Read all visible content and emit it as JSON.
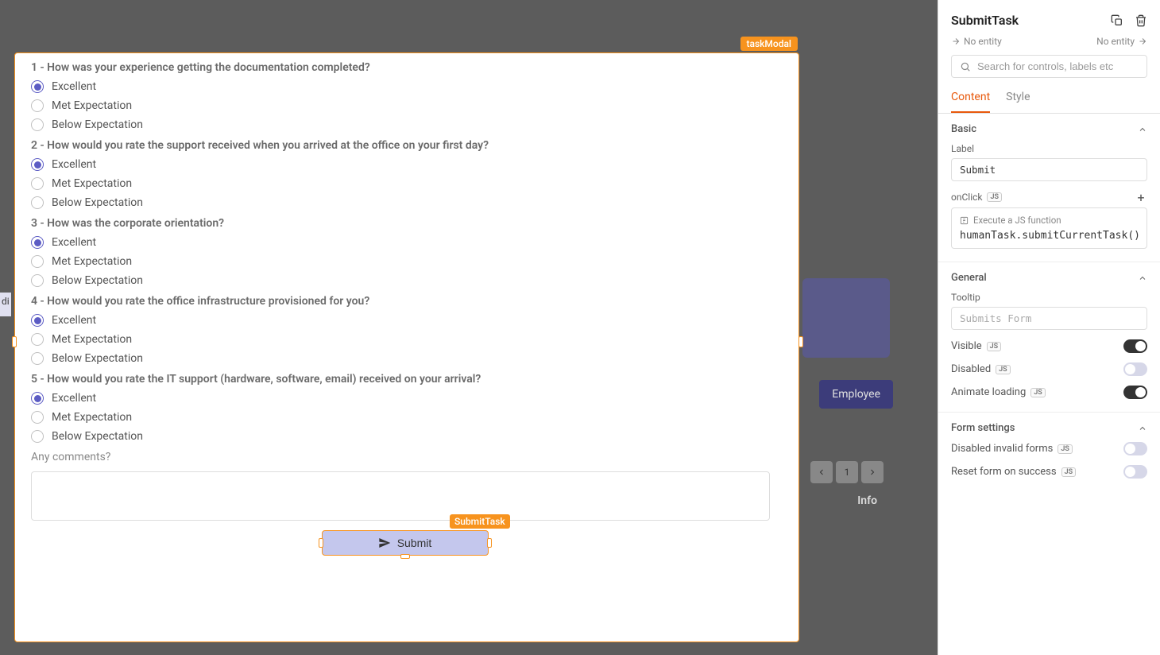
{
  "modal": {
    "tag": "taskModal",
    "questions": [
      {
        "title": "1 - How was your experience getting the documentation completed?",
        "options": [
          "Excellent",
          "Met Expectation",
          "Below Expectation"
        ],
        "selected": 0
      },
      {
        "title": "2 - How would you rate the support received when you arrived at the office on your first day?",
        "options": [
          "Excellent",
          "Met Expectation",
          "Below Expectation"
        ],
        "selected": 0
      },
      {
        "title": "3 - How was the corporate orientation?",
        "options": [
          "Excellent",
          "Met Expectation",
          "Below Expectation"
        ],
        "selected": 0
      },
      {
        "title": "4 - How would you rate the office infrastructure provisioned for you?",
        "options": [
          "Excellent",
          "Met Expectation",
          "Below Expectation"
        ],
        "selected": 0
      },
      {
        "title": "5 - How would you rate the IT support (hardware, software, email) received on your arrival?",
        "options": [
          "Excellent",
          "Met Expectation",
          "Below Expectation"
        ],
        "selected": 0
      }
    ],
    "commentsLabel": "Any comments?",
    "submit": {
      "tag": "SubmitTask",
      "label": "Submit"
    }
  },
  "background": {
    "button": "Employee",
    "info": "Info",
    "page": "1",
    "di": "di"
  },
  "panel": {
    "title": "SubmitTask",
    "entityLeft": "No entity",
    "entityRight": "No entity",
    "searchPlaceholder": "Search for controls, labels etc",
    "tabs": {
      "content": "Content",
      "style": "Style"
    },
    "basic": {
      "title": "Basic",
      "labelField": "Label",
      "labelValue": "Submit",
      "onClickField": "onClick",
      "actionHeader": "Execute a JS function",
      "actionCode": "humanTask.submitCurrentTask()"
    },
    "general": {
      "title": "General",
      "tooltipField": "Tooltip",
      "tooltipPlaceholder": "Submits Form",
      "visible": "Visible",
      "disabled": "Disabled",
      "animate": "Animate loading"
    },
    "form": {
      "title": "Form settings",
      "invalid": "Disabled invalid forms",
      "reset": "Reset form on success"
    },
    "jsBadge": "JS"
  }
}
